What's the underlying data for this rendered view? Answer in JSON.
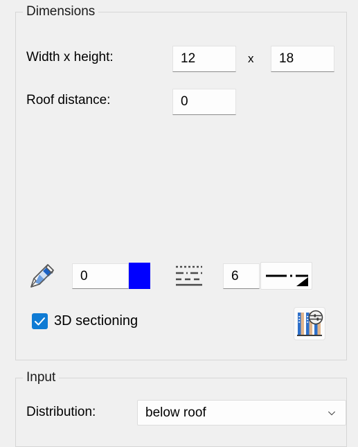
{
  "groups": {
    "dimensions": {
      "title": "Dimensions",
      "width_height_label": "Width x height:",
      "width_value": "12",
      "times_separator": "x",
      "height_value": "18",
      "roof_distance_label": "Roof distance:",
      "roof_distance_value": "0",
      "pen_width_value": "0",
      "pen_color": "#0000ff",
      "line_weight_value": "6",
      "sectioning_checkbox_label": "3D sectioning",
      "sectioning_checkbox_checked": true,
      "checkbox_accent": "#0f7bd4",
      "icons": {
        "pencil": "pencil-icon",
        "linestyle": "line-style-icon",
        "linestyle_preview": "line-style-preview-icon",
        "section_settings": "section-settings-icon"
      }
    },
    "input": {
      "title": "Input",
      "distribution_label": "Distribution:",
      "distribution_value": "below roof",
      "distribution_icon": "chevron-down-icon"
    }
  }
}
